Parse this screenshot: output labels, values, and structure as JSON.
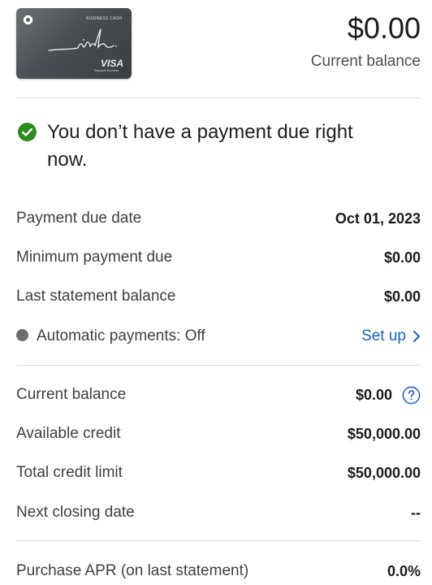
{
  "card": {
    "product_line": "BUSINESS CASH",
    "brand": "VISA",
    "tier": "Signature Business"
  },
  "header": {
    "balance_amount": "$0.00",
    "balance_label": "Current balance"
  },
  "status": {
    "message": "You don’t have a payment due right now."
  },
  "payment": {
    "due_date_label": "Payment due date",
    "due_date_value": "Oct 01, 2023",
    "min_payment_label": "Minimum payment due",
    "min_payment_value": "$0.00",
    "last_statement_label": "Last statement balance",
    "last_statement_value": "$0.00",
    "autopay_label": "Automatic payments: Off",
    "autopay_action": "Set up"
  },
  "account": {
    "current_balance_label": "Current balance",
    "current_balance_value": "$0.00",
    "available_credit_label": "Available credit",
    "available_credit_value": "$50,000.00",
    "credit_limit_label": "Total credit limit",
    "credit_limit_value": "$50,000.00",
    "next_closing_label": "Next closing date",
    "next_closing_value": "--",
    "apr_label": "Purchase APR (on last statement)",
    "apr_value": "0.0%"
  },
  "colors": {
    "link": "#1b62c0",
    "success": "#2e8b22",
    "autopay_dot": "#6e6e6e",
    "divider": "#dcdcdc"
  },
  "icons": {
    "status": "check-circle-icon",
    "autopay": "status-dot-icon",
    "setup": "chevron-right-icon",
    "help": "question-circle-icon",
    "bank_logo": "chase-octagon-icon"
  }
}
